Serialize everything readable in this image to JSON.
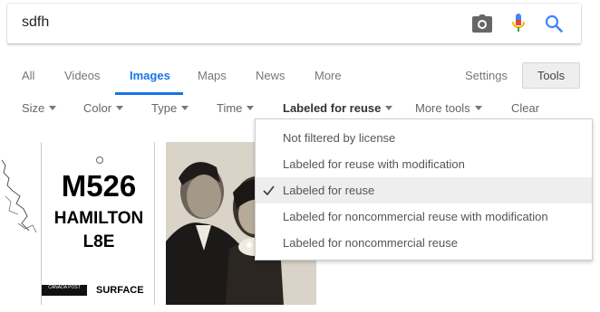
{
  "search": {
    "query": "sdfh"
  },
  "icons": {
    "camera": "camera-icon",
    "mic": "microphone-icon",
    "search": "search-icon"
  },
  "tabs": [
    {
      "label": "All"
    },
    {
      "label": "Videos"
    },
    {
      "label": "Images"
    },
    {
      "label": "Maps"
    },
    {
      "label": "News"
    },
    {
      "label": "More"
    }
  ],
  "active_tab": "Images",
  "settings_label": "Settings",
  "tools_label": "Tools",
  "toolbar": [
    {
      "label": "Size"
    },
    {
      "label": "Color"
    },
    {
      "label": "Type"
    },
    {
      "label": "Time"
    },
    {
      "label": "Labeled for reuse"
    },
    {
      "label": "More tools"
    },
    {
      "label": "Clear"
    }
  ],
  "license_menu": [
    {
      "label": "Not filtered by license",
      "selected": false
    },
    {
      "label": "Labeled for reuse with modification",
      "selected": false
    },
    {
      "label": "Labeled for reuse",
      "selected": true
    },
    {
      "label": "Labeled for noncommercial reuse with modification",
      "selected": false
    },
    {
      "label": "Labeled for noncommercial reuse",
      "selected": false
    }
  ],
  "results": {
    "sign": {
      "line1": "M526",
      "line2": "HAMILTON",
      "line3": "L8E",
      "footer": "SURFACE",
      "logo_text": "CANADA POST"
    }
  },
  "colors": {
    "accent": "#1a73e8",
    "selected_bg": "#eeeeee"
  }
}
